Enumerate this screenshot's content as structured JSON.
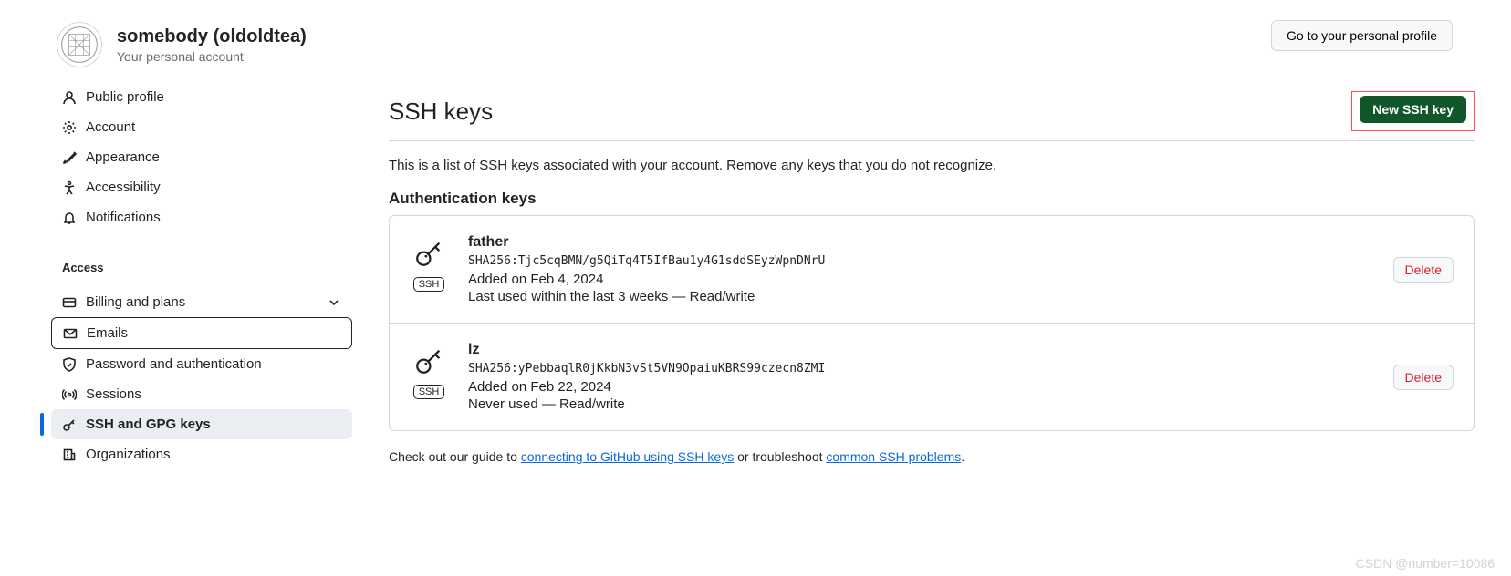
{
  "header": {
    "display_name": "somebody (oldoldtea)",
    "subtitle": "Your personal account",
    "profile_button": "Go to your personal profile"
  },
  "sidebar": {
    "group1": [
      {
        "id": "public-profile",
        "label": "Public profile",
        "icon": "person"
      },
      {
        "id": "account",
        "label": "Account",
        "icon": "gear"
      },
      {
        "id": "appearance",
        "label": "Appearance",
        "icon": "brush"
      },
      {
        "id": "accessibility",
        "label": "Accessibility",
        "icon": "accessibility"
      },
      {
        "id": "notifications",
        "label": "Notifications",
        "icon": "bell"
      }
    ],
    "access_heading": "Access",
    "group2": [
      {
        "id": "billing",
        "label": "Billing and plans",
        "icon": "credit-card",
        "expandable": true
      },
      {
        "id": "emails",
        "label": "Emails",
        "icon": "mail",
        "boxed": true
      },
      {
        "id": "password",
        "label": "Password and authentication",
        "icon": "shield"
      },
      {
        "id": "sessions",
        "label": "Sessions",
        "icon": "broadcast"
      },
      {
        "id": "ssh",
        "label": "SSH and GPG keys",
        "icon": "key",
        "current": true
      },
      {
        "id": "orgs",
        "label": "Organizations",
        "icon": "organization"
      }
    ]
  },
  "main": {
    "title": "SSH keys",
    "new_button": "New SSH key",
    "description": "This is a list of SSH keys associated with your account. Remove any keys that you do not recognize.",
    "auth_heading": "Authentication keys",
    "keys": [
      {
        "name": "father",
        "fingerprint": "SHA256:Tjc5cqBMN/g5QiTq4T5IfBau1y4G1sddSEyzWpnDNrU",
        "added": "Added on Feb 4, 2024",
        "used": "Last used within the last 3 weeks — Read/write",
        "badge": "SSH",
        "delete": "Delete"
      },
      {
        "name": "lz",
        "fingerprint": "SHA256:yPebbaqlR0jKkbN3vSt5VN9OpaiuKBRS99czecn8ZMI",
        "added": "Added on Feb 22, 2024",
        "used": "Never used — Read/write",
        "badge": "SSH",
        "delete": "Delete"
      }
    ],
    "footer_pre": "Check out our guide to ",
    "footer_link1": "connecting to GitHub using SSH keys",
    "footer_mid": " or troubleshoot ",
    "footer_link2": "common SSH problems",
    "footer_post": "."
  },
  "watermark": "CSDN @number=10086"
}
